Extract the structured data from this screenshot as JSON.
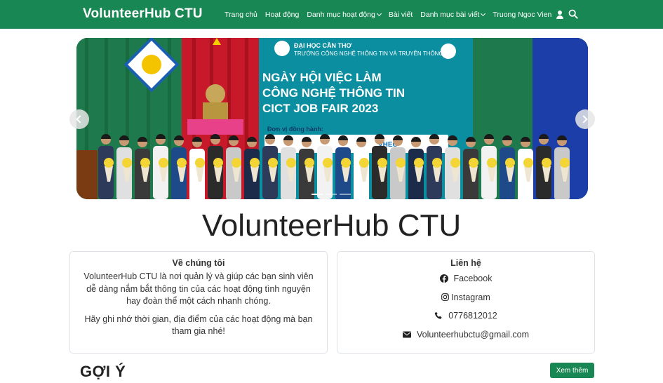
{
  "navbar": {
    "brand": "VolunteerHub CTU",
    "items": [
      {
        "label": "Trang chủ",
        "dropdown": false
      },
      {
        "label": "Hoạt động",
        "dropdown": false
      },
      {
        "label": "Danh mục hoạt động",
        "dropdown": true
      },
      {
        "label": "Bài viết",
        "dropdown": false
      },
      {
        "label": "Danh mục bài viết",
        "dropdown": true
      }
    ],
    "user_name": "Truong Ngoc Vien",
    "icons": {
      "user": "user-icon",
      "search": "search-icon"
    }
  },
  "carousel": {
    "slide": {
      "university": "ĐẠI HỌC CẦN THƠ",
      "school": "TRƯỜNG CÔNG NGHỆ THÔNG TIN VÀ TRUYỀN THÔNG",
      "line1": "NGÀY HỘI VIỆC LÀM",
      "line2": "CÔNG NGHỆ THÔNG TIN",
      "line3": "CICT JOB FAIR 2023",
      "sponsors_label": "Đơn vị đồng hành:",
      "sponsor_vhec": "VHEC",
      "logo_text": "ĐẠI HỌC CẦN THƠ"
    },
    "active_index": 0,
    "slide_count": 3
  },
  "hero": {
    "title": "VolunteerHub CTU"
  },
  "about": {
    "title": "Về chúng tôi",
    "paragraph1": "VolunteerHub CTU là nơi quản lý và giúp các bạn sinh viên dễ dàng nắm bắt thông tin của các hoạt động tình nguyện hay đoàn thể một cách nhanh chóng.",
    "paragraph2": "Hãy ghi nhớ thời gian, địa điểm của các hoạt động mà bạn tham gia nhé!"
  },
  "contact": {
    "title": "Liên hệ",
    "facebook": "Facebook",
    "instagram": "Instagram",
    "phone": "0776812012",
    "email": "Volunteerhubctu@gmail.com"
  },
  "suggestions": {
    "title": "GỢI Ý",
    "more_button": "Xem thêm"
  },
  "colors": {
    "primary": "#198754",
    "text": "#212529",
    "border": "#dee2e6"
  }
}
